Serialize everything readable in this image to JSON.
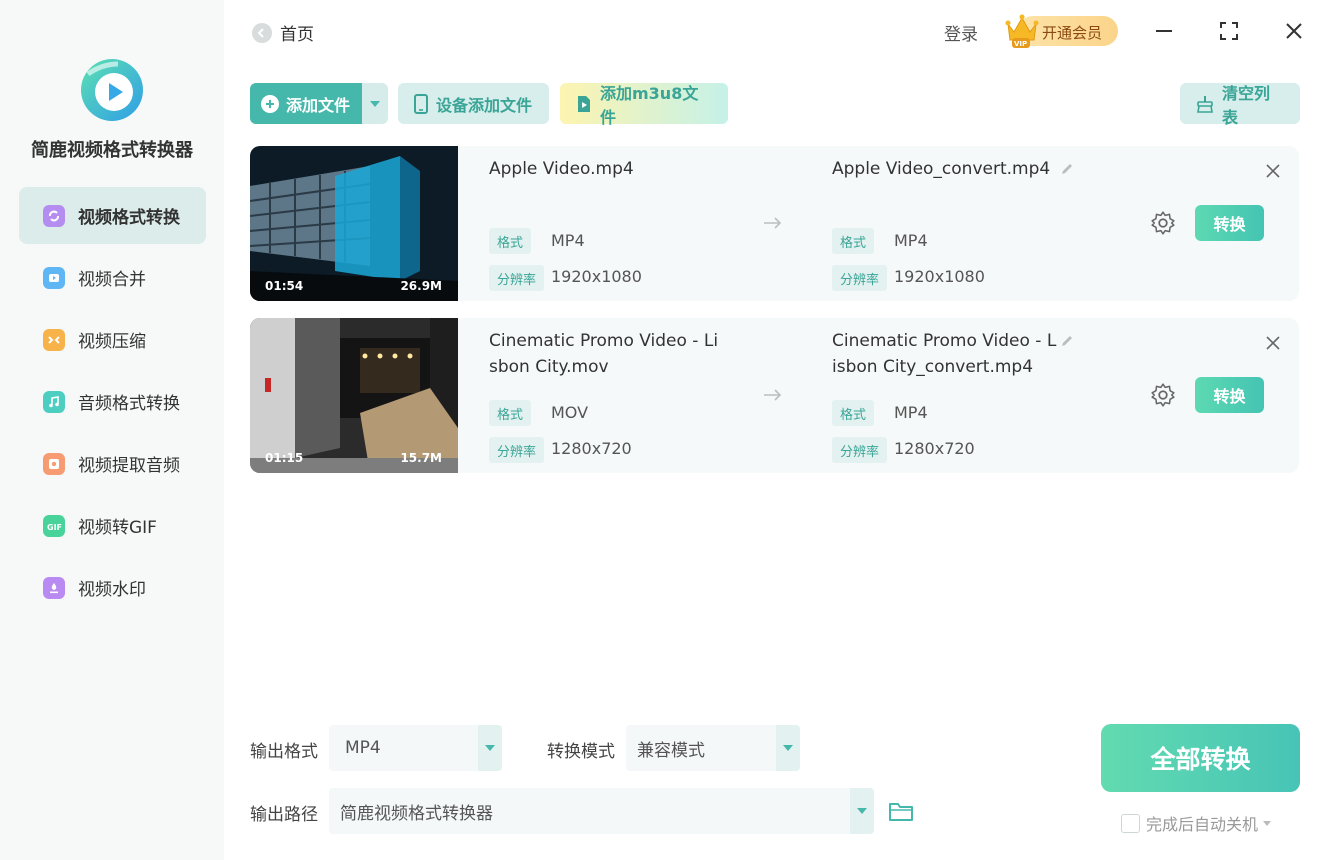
{
  "app": {
    "name": "简鹿视频格式转换器",
    "brand_color": "#45b8ab"
  },
  "sidebar": {
    "items": [
      {
        "label": "视频格式转换",
        "icon": "video-convert-icon",
        "color": "#b58cf0",
        "active": true
      },
      {
        "label": "视频合并",
        "icon": "video-merge-icon",
        "color": "#5fb6f5",
        "active": false
      },
      {
        "label": "视频压缩",
        "icon": "video-compress-icon",
        "color": "#f7b24a",
        "active": false
      },
      {
        "label": "音频格式转换",
        "icon": "audio-convert-icon",
        "color": "#4ccfc0",
        "active": false
      },
      {
        "label": "视频提取音频",
        "icon": "extract-audio-icon",
        "color": "#f79b73",
        "active": false
      },
      {
        "label": "视频转GIF",
        "icon": "gif-icon",
        "color": "#48d39a",
        "active": false
      },
      {
        "label": "视频水印",
        "icon": "watermark-icon",
        "color": "#b88af2",
        "active": false
      }
    ]
  },
  "header": {
    "back_label": "首页",
    "login_label": "登录",
    "vip_label": "开通会员",
    "vip_badge": "VIP"
  },
  "toolbar": {
    "add_file": "添加文件",
    "device_add": "设备添加文件",
    "add_m3u8": "添加m3u8文件",
    "clear_list": "清空列表"
  },
  "files": [
    {
      "source_name": "Apple Video.mp4",
      "output_name": "Apple Video_convert.mp4",
      "duration": "01:54",
      "size": "26.9M",
      "format_label": "格式",
      "resolution_label": "分辨率",
      "source_format": "MP4",
      "source_resolution": "1920x1080",
      "output_format": "MP4",
      "output_resolution": "1920x1080",
      "convert_label": "转换"
    },
    {
      "source_name_line1": "Cinematic Promo Video - Li",
      "source_name_line2": "sbon City.mov",
      "output_name_line1": "Cinematic Promo Video - L",
      "output_name_line2": "isbon City_convert.mp4",
      "duration": "01:15",
      "size": "15.7M",
      "format_label": "格式",
      "resolution_label": "分辨率",
      "source_format": "MOV",
      "source_resolution": "1280x720",
      "output_format": "MP4",
      "output_resolution": "1280x720",
      "convert_label": "转换"
    }
  ],
  "bottom": {
    "output_format_label": "输出格式",
    "output_format_value": "MP4",
    "mode_label": "转换模式",
    "mode_value": "兼容模式",
    "output_path_label": "输出路径",
    "output_path_value": "简鹿视频格式转换器",
    "convert_all": "全部转换",
    "auto_shutdown": "完成后自动关机"
  }
}
